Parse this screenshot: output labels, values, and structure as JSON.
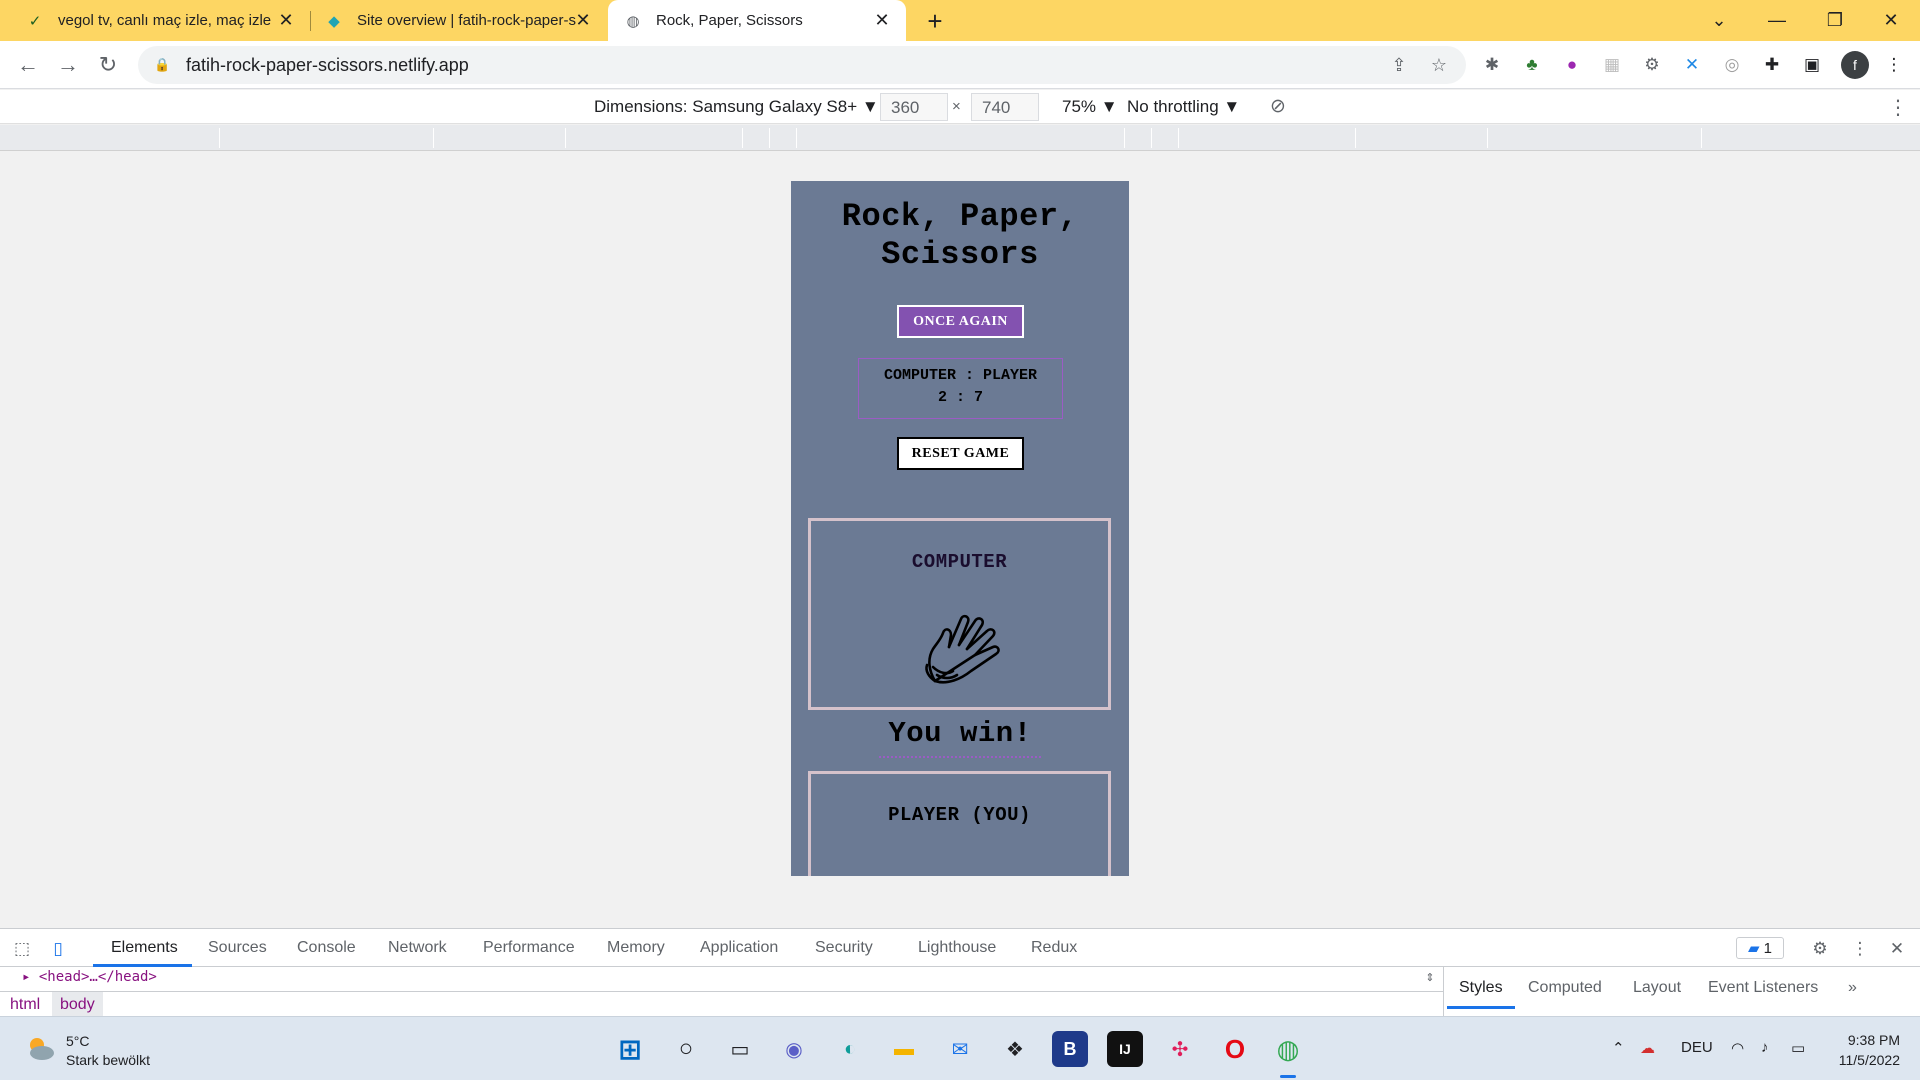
{
  "tabs": [
    {
      "title": "vegol tv, canlı maç izle, maç izle",
      "favicon": "vegol-icon",
      "glyph": "✓"
    },
    {
      "title": "Site overview | fatih-rock-paper-s",
      "favicon": "netlify-icon",
      "glyph": "◆"
    },
    {
      "title": "Rock, Paper, Scissors",
      "favicon": "globe-icon",
      "glyph": "◍"
    }
  ],
  "address": {
    "url": "fatih-rock-paper-scissors.netlify.app"
  },
  "device_toolbar": {
    "dimensions": "Dimensions: Samsung Galaxy S8+ ▼",
    "width": "360",
    "height": "740",
    "times": "×",
    "zoom": "75% ▼",
    "throttling": "No throttling ▼"
  },
  "game": {
    "title_line1": "Rock, Paper,",
    "title_line2": "Scissors",
    "once_again": "ONCE AGAIN",
    "score_header": "COMPUTER : PLAYER",
    "score_values": "2 : 7",
    "computer_score": 2,
    "player_score": 7,
    "reset": "RESET GAME",
    "computer_label": "COMPUTER",
    "computer_choice": "paper",
    "result": "You win!",
    "player_label": "PLAYER (YOU)",
    "colors": {
      "background": "#6b7a94",
      "accent": "#8352b0",
      "panel_border": "#d5c2cb"
    }
  },
  "devtools": {
    "tabs": [
      "Elements",
      "Sources",
      "Console",
      "Network",
      "Performance",
      "Memory",
      "Application",
      "Security",
      "Lighthouse",
      "Redux"
    ],
    "active_tab": "Elements",
    "code_line": "▸ <head>…</head>",
    "breadcrumbs": [
      "html",
      "body"
    ],
    "issues_count": "1",
    "side_tabs": [
      "Styles",
      "Computed",
      "Layout",
      "Event Listeners"
    ],
    "side_more": "»"
  },
  "taskbar": {
    "temperature": "5°C",
    "condition": "Stark bewölkt",
    "language": "DEU",
    "time": "9:38 PM",
    "date": "11/5/2022"
  }
}
